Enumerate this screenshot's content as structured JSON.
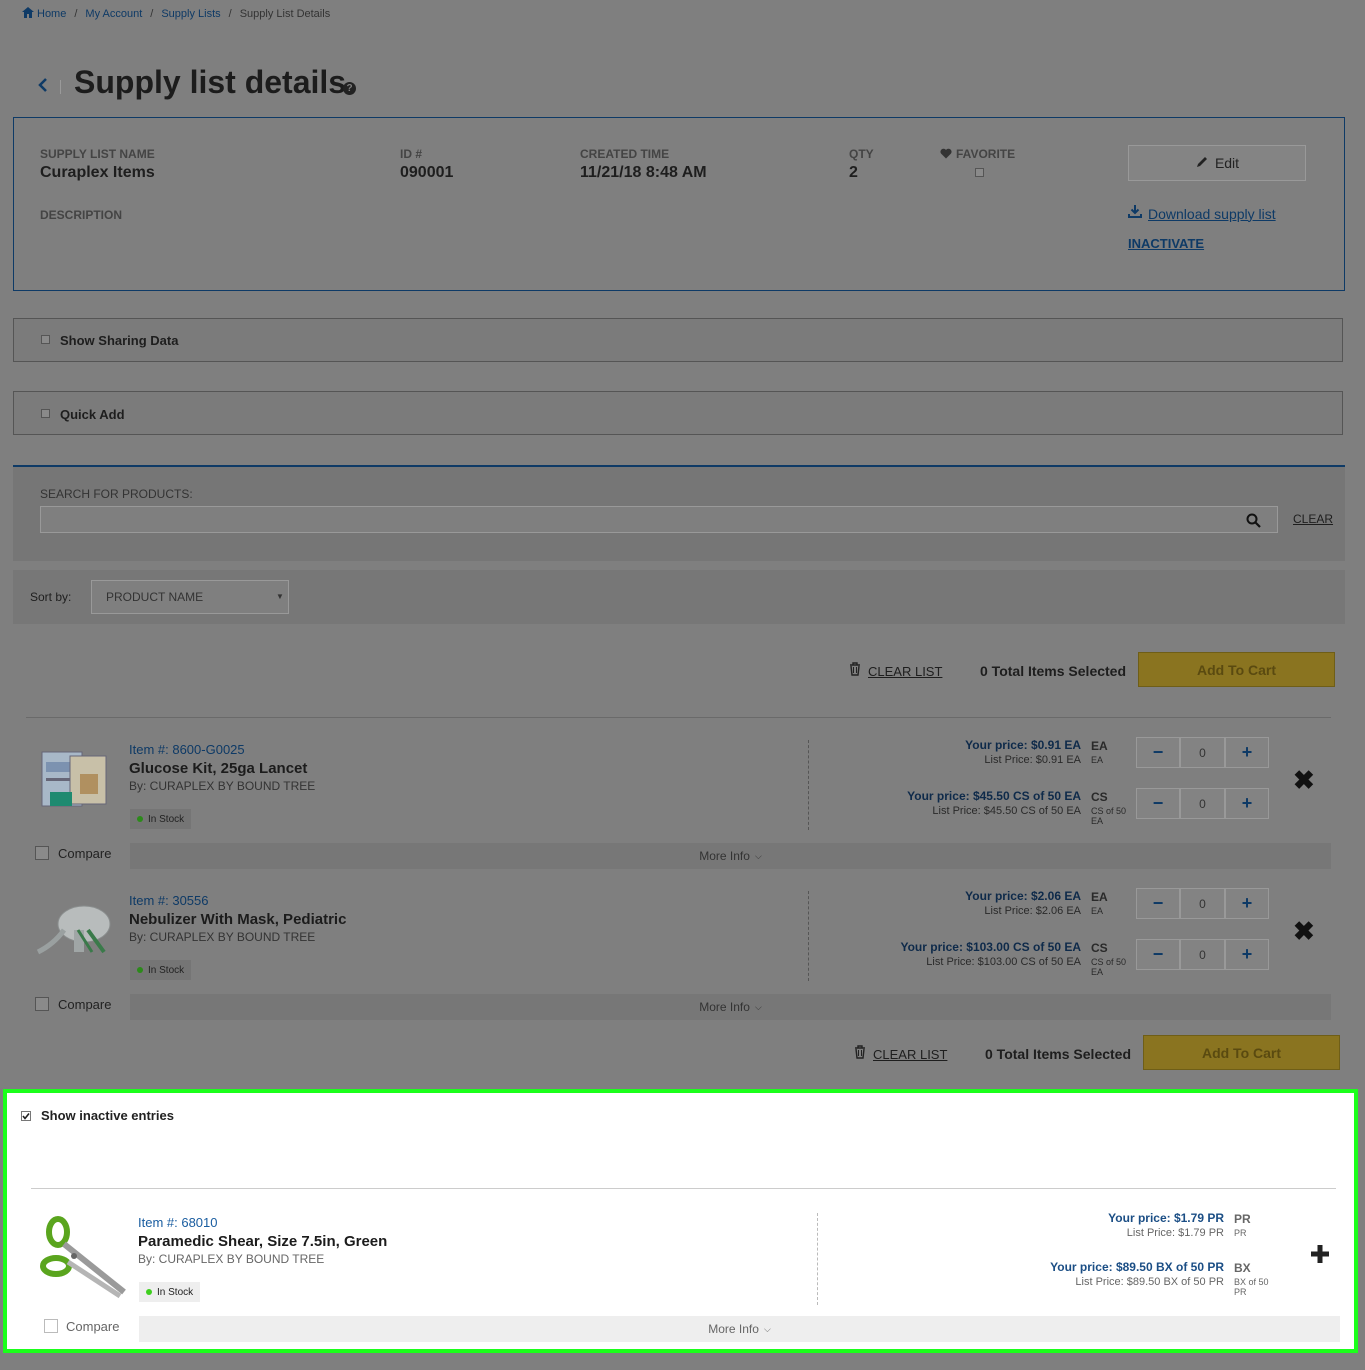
{
  "breadcrumb": {
    "items": [
      "Home",
      "My Account",
      "Supply Lists",
      "Supply List Details"
    ],
    "separator": "/"
  },
  "page": {
    "title": "Supply list details",
    "help_icon": "?"
  },
  "details": {
    "name_label": "SUPPLY LIST NAME",
    "name_value": "Curaplex Items",
    "id_label": "ID #",
    "id_value": "090001",
    "created_label": "CREATED TIME",
    "created_value": "11/21/18 8:48 AM",
    "qty_label": "QTY",
    "qty_value": "2",
    "favorite_label": "FAVORITE",
    "description_label": "DESCRIPTION",
    "edit_label": "Edit",
    "download_label": "Download supply list",
    "inactivate_label": "INACTIVATE"
  },
  "panels": {
    "sharing_label": "Show Sharing Data",
    "quick_add_label": "Quick Add"
  },
  "search": {
    "label": "SEARCH FOR PRODUCTS:",
    "value": "",
    "clear_label": "CLEAR"
  },
  "sort": {
    "label": "Sort by:",
    "selected": "PRODUCT NAME"
  },
  "toolbar": {
    "clear_list": "CLEAR LIST",
    "total_selected": "0 Total Items Selected",
    "add_to_cart": "Add To Cart"
  },
  "products": [
    {
      "item": "Item #: 8600-G0025",
      "name": "Glucose Kit, 25ga Lancet",
      "by": "By: CURAPLEX BY BOUND TREE",
      "stock": "In Stock",
      "compare": "Compare",
      "more": "More Info",
      "uoms": [
        {
          "your_price": "Your price: $0.91 EA",
          "list_price": "List Price: $0.91 EA",
          "code": "EA",
          "sub": "EA",
          "qty": "0"
        },
        {
          "your_price": "Your price: $45.50 CS of 50 EA",
          "list_price": "List Price: $45.50 CS of 50 EA",
          "code": "CS",
          "sub": "CS of 50 EA",
          "qty": "0"
        }
      ]
    },
    {
      "item": "Item #: 30556",
      "name": "Nebulizer With Mask, Pediatric",
      "by": "By: CURAPLEX BY BOUND TREE",
      "stock": "In Stock",
      "compare": "Compare",
      "more": "More Info",
      "uoms": [
        {
          "your_price": "Your price: $2.06 EA",
          "list_price": "List Price: $2.06 EA",
          "code": "EA",
          "sub": "EA",
          "qty": "0"
        },
        {
          "your_price": "Your price: $103.00 CS of 50 EA",
          "list_price": "List Price: $103.00 CS of 50 EA",
          "code": "CS",
          "sub": "CS of 50 EA",
          "qty": "0"
        }
      ]
    }
  ],
  "inactive": {
    "show_label": "Show inactive entries",
    "product": {
      "item": "Item #: 68010",
      "name": "Paramedic Shear, Size 7.5in, Green",
      "by": "By: CURAPLEX BY BOUND TREE",
      "stock": "In Stock",
      "compare": "Compare",
      "more": "More Info",
      "uoms": [
        {
          "your_price": "Your price: $1.79 PR",
          "list_price": "List Price: $1.79 PR",
          "code": "PR",
          "sub": "PR"
        },
        {
          "your_price": "Your price: $89.50 BX of 50 PR",
          "list_price": "List Price: $89.50 BX of 50 PR",
          "code": "BX",
          "sub": "BX of 50 PR"
        }
      ]
    }
  },
  "colors": {
    "brand_blue": "#0e3a66",
    "highlight_green": "#1bff1b",
    "add_to_cart": "#8a7420",
    "in_stock": "#3ecf1e"
  }
}
